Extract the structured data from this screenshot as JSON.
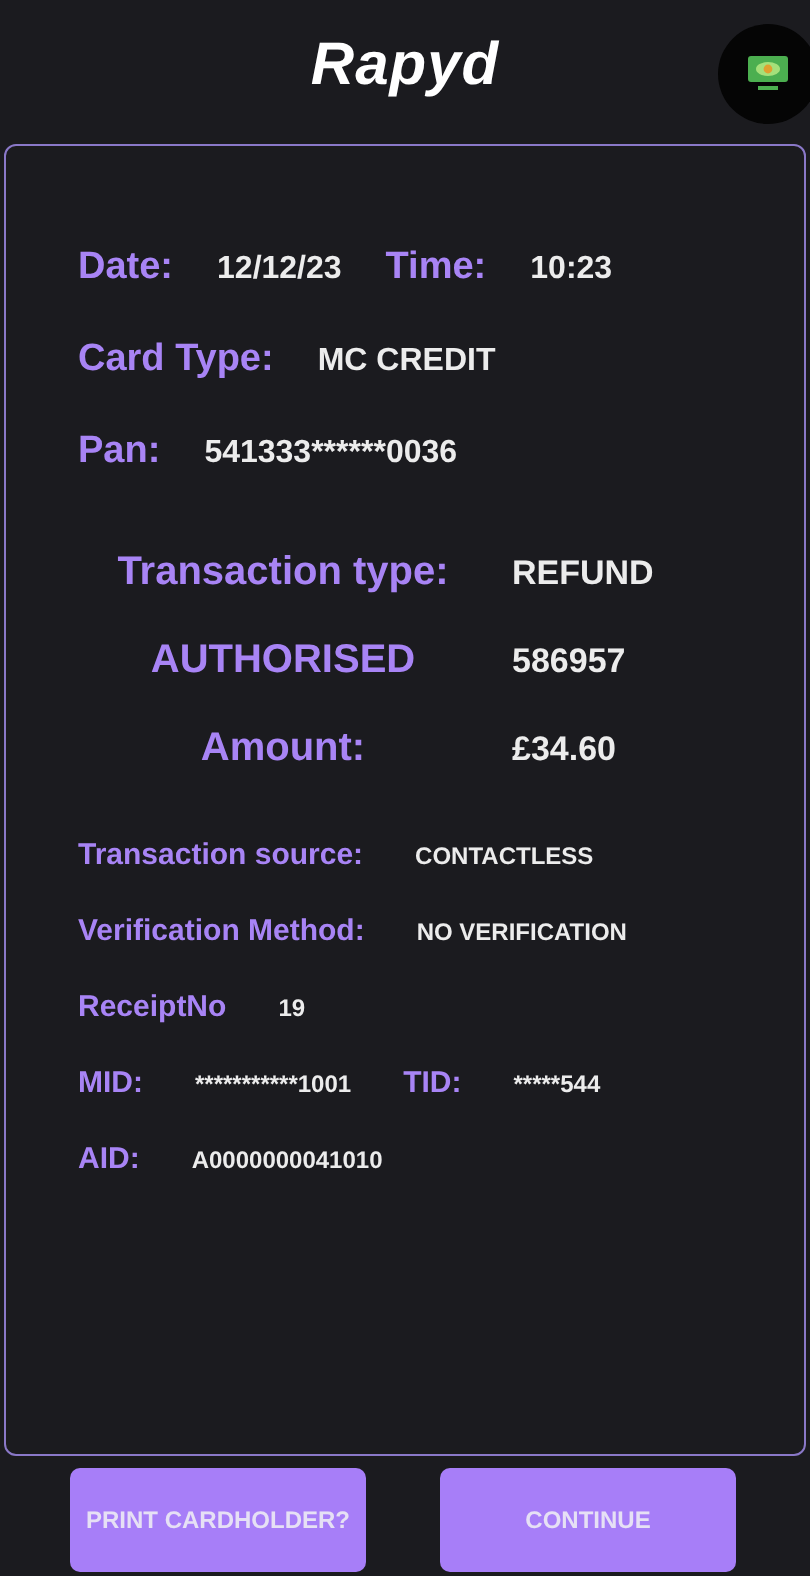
{
  "header": {
    "logo": "Rapyd"
  },
  "sections": [
    {
      "kind": "top",
      "rows": [
        [
          {
            "label": "Date:",
            "value": "12/12/23"
          },
          {
            "label": "Time:",
            "value": "10:23"
          }
        ],
        [
          {
            "label": "Card Type:",
            "value": "MC CREDIT"
          }
        ],
        [
          {
            "label": "Pan:",
            "value": "541333******0036"
          }
        ]
      ]
    },
    {
      "kind": "summary",
      "rows": [
        [
          {
            "label": "Transaction type:",
            "value": "REFUND"
          }
        ],
        [
          {
            "label": "AUTHORISED",
            "value": "586957"
          }
        ],
        [
          {
            "label": "Amount:",
            "value": "£34.60"
          }
        ]
      ]
    },
    {
      "kind": "detail",
      "rows": [
        [
          {
            "label": "Transaction source:",
            "value": "CONTACTLESS"
          }
        ],
        [
          {
            "label": "Verification Method:",
            "value": "NO VERIFICATION"
          }
        ],
        [
          {
            "label": "ReceiptNo",
            "value": "19"
          }
        ],
        [
          {
            "label": "MID:",
            "value": "***********1001"
          },
          {
            "label": "TID:",
            "value": "*****544"
          }
        ],
        [
          {
            "label": "AID:",
            "value": "A0000000041010"
          }
        ]
      ]
    }
  ],
  "buttons": [
    {
      "label": "PRINT CARDHOLDER?"
    },
    {
      "label": "CONTINUE"
    }
  ]
}
